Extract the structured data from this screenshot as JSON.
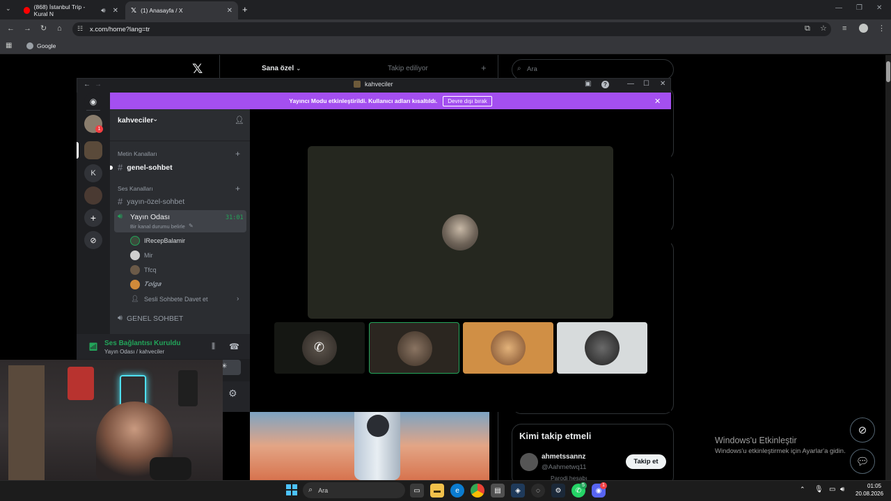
{
  "browser": {
    "tabs": [
      {
        "label": "(868) İstanbul Trip - Kural N"
      },
      {
        "label": "(1) Anasayfa / X"
      }
    ],
    "url": "x.com/home?lang=tr",
    "bookmark": "Google",
    "new_tab": "+"
  },
  "x": {
    "tab_for_you": "Sana özel",
    "tab_following": "Takip ediliyor",
    "search_placeholder": "Ara",
    "who_to_follow": "Kimi takip etmeli",
    "suggestion": {
      "name": "ahmetssannz",
      "handle": "@Aahmetwq11",
      "note": "Parodi hesabı",
      "follow": "Takip et"
    }
  },
  "discord": {
    "title": "kahveciler",
    "banner_text": "Yayıncı Modu etkinleştirildi. Kullanıcı adları kısaltıldı.",
    "banner_button": "Devre dışı bırak",
    "server_name": "kahveciler",
    "guild_letter": "K",
    "mention_badge": "1",
    "text_category": "Metin Kanalları",
    "voice_category": "Ses Kanalları",
    "text_channel": "genel-sohbet",
    "voice_text_channel": "yayın-özel-sohbet",
    "voice_channel": "Yayın Odası",
    "voice_status": "Bir kanal durumu belirle",
    "voice_timer": "31:01",
    "voice_users": [
      "IRecepBalamir",
      "Mir",
      "Tfcq",
      "𝑻𝒐𝒍𝒈𝒂"
    ],
    "invite": "Sesli Sohbete Davet et",
    "other_voice": "GENEL SOHBET",
    "connection_status": "Ses Bağlantısı Kuruldu",
    "connection_detail": "Yayın Odası / kahveciler"
  },
  "windows": {
    "watermark_title": "Windows'u Etkinleştir",
    "watermark_sub": "Windows'u etkinleştirmek için Ayarlar'a gidin.",
    "search": "Ara",
    "time": "01:05",
    "date": "20.08.2026",
    "badge_whatsapp": "5",
    "badge_discord": "1"
  },
  "colors": {
    "discord_banner": "#a44ff0",
    "voice_green": "#23a55a",
    "discord_blurple": "#5865f2"
  }
}
